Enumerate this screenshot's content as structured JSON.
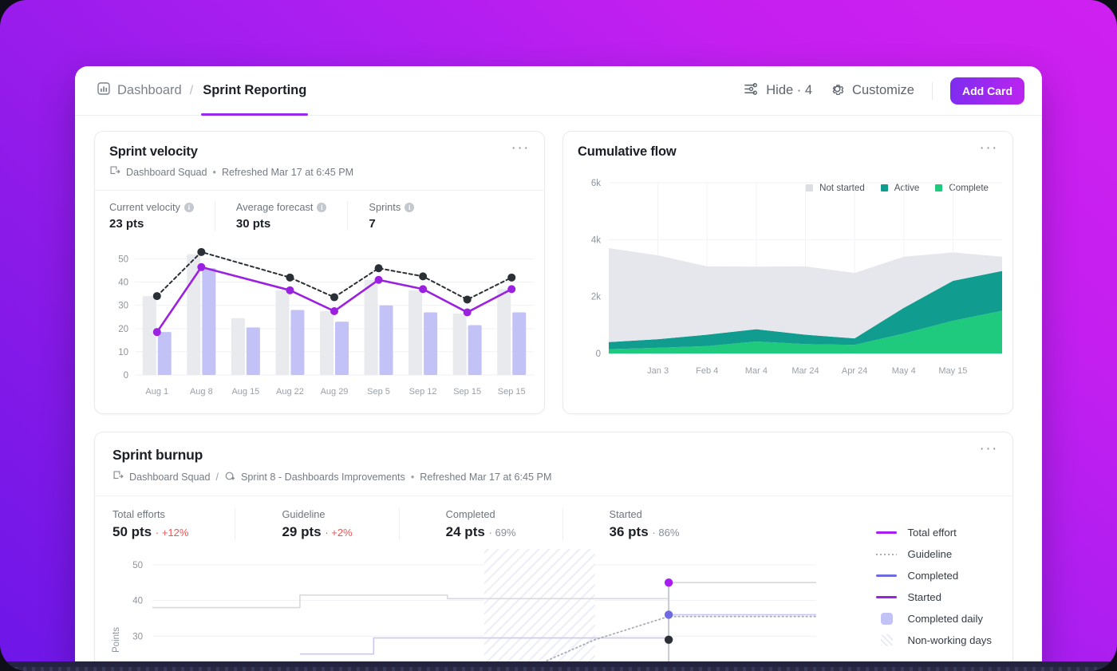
{
  "theme": {
    "bg_gradient_from": "#6d16e8",
    "bg_gradient_to": "#cf20f0",
    "accent": "#9c28f0",
    "purple_line": "#9b21e0",
    "light_purple_bar": "#c3c2f7",
    "grey_bar": "#e8eaee",
    "teal": "#119c90",
    "green": "#1fc97d",
    "red": "#f05252"
  },
  "header": {
    "breadcrumb_home": "Dashboard",
    "breadcrumb_sep": "/",
    "breadcrumb_active": "Sprint Reporting",
    "hide_label": "Hide · 4",
    "customize_label": "Customize",
    "add_card_label": "Add Card",
    "icons": {
      "dashboard": "dashboard-icon",
      "hide": "sliders-icon",
      "customize": "gear-icon"
    }
  },
  "sprint_velocity": {
    "title": "Sprint velocity",
    "subtitle_squad": "Dashboard Squad",
    "subtitle_sep": "•",
    "subtitle_refreshed": "Refreshed Mar 17 at 6:45 PM",
    "kebab": "···",
    "metrics": [
      {
        "label": "Current velocity",
        "value": "23 pts"
      },
      {
        "label": "Average forecast",
        "value": "30 pts"
      },
      {
        "label": "Sprints",
        "value": "7"
      }
    ]
  },
  "cumulative_flow": {
    "title": "Cumulative flow",
    "kebab": "···",
    "legend": [
      {
        "label": "Not started",
        "color": "#dcdee3"
      },
      {
        "label": "Active",
        "color": "#119c90"
      },
      {
        "label": "Complete",
        "color": "#1fc97d"
      }
    ]
  },
  "sprint_burnup": {
    "title": "Sprint burnup",
    "subtitle_squad": "Dashboard Squad",
    "subtitle_slash": "/",
    "subtitle_sprint": "Sprint 8 - Dashboards Improvements",
    "subtitle_sep": "•",
    "subtitle_refreshed": "Refreshed Mar 17 at 6:45 PM",
    "kebab": "···",
    "metrics": [
      {
        "label": "Total efforts",
        "value": "50 pts",
        "delta": "+12%",
        "delta_kind": "red"
      },
      {
        "label": "Guideline",
        "value": "29 pts",
        "delta": "+2%",
        "delta_kind": "red"
      },
      {
        "label": "Completed",
        "value": "24 pts",
        "delta": "69%",
        "delta_kind": "grey"
      },
      {
        "label": "Started",
        "value": "36 pts",
        "delta": "86%",
        "delta_kind": "grey"
      }
    ],
    "legend": [
      {
        "label": "Total effort",
        "type": "line",
        "color": "#a81ef0"
      },
      {
        "label": "Guideline",
        "type": "dots",
        "color": "#a9aeb6"
      },
      {
        "label": "Completed",
        "type": "line",
        "color": "#6f6ae0"
      },
      {
        "label": "Started",
        "type": "line",
        "color": "#9b21e0"
      },
      {
        "label": "Completed daily",
        "type": "box",
        "color": "#c3c2f7"
      },
      {
        "label": "Non-working days",
        "type": "hatch",
        "color": "#e7e9f5"
      }
    ],
    "y_axis_title": "Points"
  },
  "chart_data": [
    {
      "type": "bar",
      "name": "sprint-velocity-chart",
      "title": "Sprint velocity",
      "xlabel": "",
      "ylabel": "",
      "ylim": [
        0,
        55
      ],
      "yticks": [
        0,
        10,
        20,
        30,
        40,
        50
      ],
      "grid": true,
      "categories": [
        "Aug 1",
        "Aug 8",
        "Aug 15",
        "Aug 22",
        "Aug 29",
        "Sep 5",
        "Sep 12",
        "Sep 15",
        "Sep 15"
      ],
      "series": [
        {
          "name": "Forecast",
          "kind": "bar",
          "color": "#e8eaee",
          "values": [
            34,
            52,
            24.5,
            36.5,
            27.5,
            41,
            36.5,
            26.5,
            37
          ]
        },
        {
          "name": "Completed",
          "kind": "bar",
          "color": "#c3c2f7",
          "values": [
            18.5,
            46,
            20.5,
            28,
            23,
            30,
            27,
            21.5,
            27
          ]
        },
        {
          "name": "Forecast line",
          "kind": "dotted-line",
          "color": "#2b2f36",
          "values": [
            34,
            53,
            null,
            42,
            33.5,
            46,
            42.5,
            32.5,
            42
          ]
        },
        {
          "name": "Velocity line",
          "kind": "line",
          "color": "#9b21e0",
          "values": [
            18.5,
            46.5,
            null,
            36.5,
            27.5,
            41,
            37,
            27,
            37
          ]
        }
      ]
    },
    {
      "type": "area",
      "name": "cumulative-flow-chart",
      "title": "Cumulative flow",
      "stacked": true,
      "ylim": [
        0,
        6000
      ],
      "yticks": [
        0,
        2000,
        4000,
        6000
      ],
      "ytick_labels": [
        "0",
        "2k",
        "4k",
        "6k"
      ],
      "grid": true,
      "x": [
        "",
        "Jan 3",
        "Feb 4",
        "Mar 4",
        "Mar 24",
        "Apr 24",
        "May 4",
        "May 15",
        ""
      ],
      "series": [
        {
          "name": "Complete",
          "color": "#1fc97d",
          "values": [
            150,
            200,
            260,
            420,
            330,
            300,
            700,
            1150,
            1500
          ]
        },
        {
          "name": "Active",
          "color": "#119c90",
          "values": [
            250,
            300,
            400,
            430,
            330,
            230,
            900,
            1400,
            1400
          ]
        },
        {
          "name": "Not started",
          "color": "#e5e7ec",
          "values": [
            3300,
            2950,
            2400,
            2200,
            2400,
            2300,
            1800,
            1000,
            500
          ]
        }
      ]
    },
    {
      "type": "line",
      "name": "sprint-burnup-chart",
      "title": "Sprint burnup",
      "ylabel": "Points",
      "ylim": [
        20,
        54
      ],
      "yticks": [
        30,
        40,
        50
      ],
      "grid": true,
      "series": [
        {
          "name": "Total effort",
          "kind": "step",
          "color": "#d8d8dd",
          "values": [
            38,
            38,
            41.5,
            41.5,
            40.5,
            40.5,
            40.5,
            45,
            45,
            45
          ]
        },
        {
          "name": "Started",
          "kind": "step",
          "color": "#c9c7f5",
          "values": [
            null,
            null,
            25,
            29.5,
            29.5,
            29.5,
            29.5,
            36,
            36,
            36
          ]
        },
        {
          "name": "Guideline",
          "kind": "dotted-line",
          "color": "#a9aeb6",
          "values": [
            null,
            null,
            null,
            null,
            null,
            20,
            29,
            35.5,
            35.5,
            35.5
          ]
        }
      ],
      "markers": [
        {
          "label": "Total effort",
          "value": 45,
          "color": "#a81ef0"
        },
        {
          "label": "Completed",
          "value": 36,
          "color": "#6f6ae0"
        },
        {
          "label": "Guideline",
          "value": 29,
          "color": "#2b2f36"
        }
      ],
      "non_working_band": true
    }
  ]
}
